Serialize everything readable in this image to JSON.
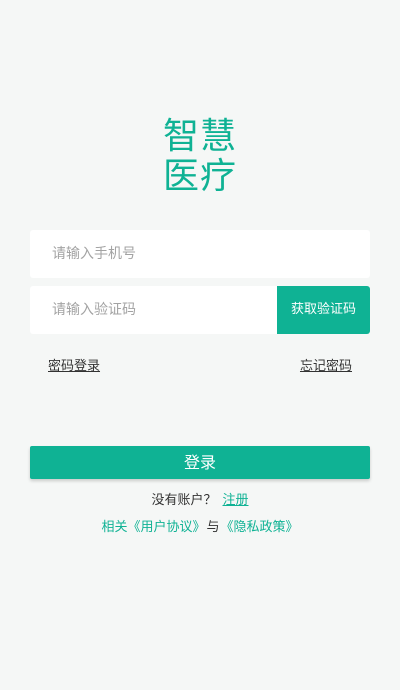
{
  "logo": {
    "line1": "智慧",
    "line2": "医疗"
  },
  "form": {
    "phone_placeholder": "请输入手机号",
    "code_placeholder": "请输入验证码",
    "get_code_label": "获取验证码"
  },
  "links": {
    "password_login": "密码登录",
    "forgot_password": "忘记密码"
  },
  "login_button": "登录",
  "register": {
    "prompt": "没有账户？",
    "link": "注册"
  },
  "agreement": {
    "prefix": "相关",
    "user_agreement": "《用户协议》",
    "and": "与",
    "privacy_policy": "《隐私政策》"
  },
  "colors": {
    "accent": "#0fb294",
    "background": "#f5f7f6"
  }
}
